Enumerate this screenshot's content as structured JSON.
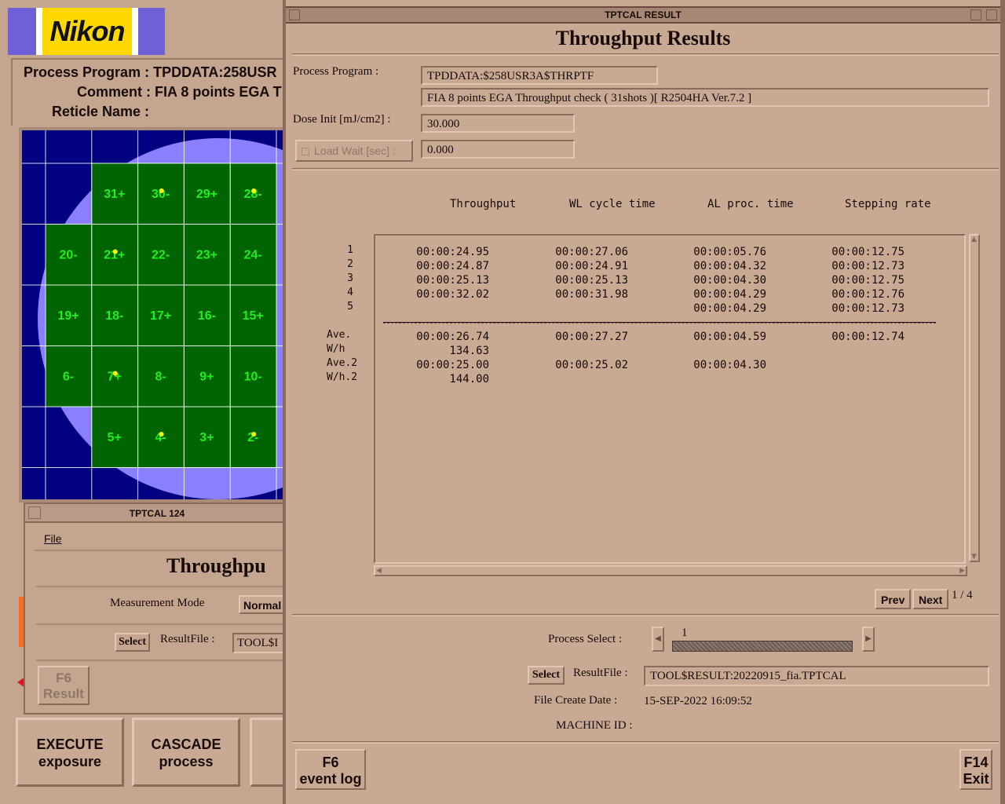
{
  "background_window": {
    "logo_text": "Nikon",
    "process_program_label": "Process Program :",
    "process_program_value": "TPDDATA:258USR",
    "comment_label": "Comment :",
    "comment_value": "FIA 8 points EGA T",
    "reticle_name_label": "Reticle Name :",
    "wafer_map": {
      "colors": {
        "background": "#000080",
        "wafer": "#8a80ff",
        "shot": "#006400",
        "label": "#22ee22",
        "marker": "#ffff00"
      },
      "shots": [
        {
          "label": "31+",
          "row": 1,
          "col": 2
        },
        {
          "label": "30-",
          "row": 1,
          "col": 3
        },
        {
          "label": "29+",
          "row": 1,
          "col": 4
        },
        {
          "label": "28-",
          "row": 1,
          "col": 5
        },
        {
          "label": "20-",
          "row": 2,
          "col": 1
        },
        {
          "label": "21+",
          "row": 2,
          "col": 2
        },
        {
          "label": "22-",
          "row": 2,
          "col": 3
        },
        {
          "label": "23+",
          "row": 2,
          "col": 4
        },
        {
          "label": "24-",
          "row": 2,
          "col": 5
        },
        {
          "label": "19+",
          "row": 3,
          "col": 1
        },
        {
          "label": "18-",
          "row": 3,
          "col": 2
        },
        {
          "label": "17+",
          "row": 3,
          "col": 3
        },
        {
          "label": "16-",
          "row": 3,
          "col": 4
        },
        {
          "label": "15+",
          "row": 3,
          "col": 5
        },
        {
          "label": "6-",
          "row": 4,
          "col": 1
        },
        {
          "label": "7+",
          "row": 4,
          "col": 2
        },
        {
          "label": "8-",
          "row": 4,
          "col": 3
        },
        {
          "label": "9+",
          "row": 4,
          "col": 4
        },
        {
          "label": "10-",
          "row": 4,
          "col": 5
        },
        {
          "label": "5+",
          "row": 5,
          "col": 2
        },
        {
          "label": "4-",
          "row": 5,
          "col": 3
        },
        {
          "label": "3+",
          "row": 5,
          "col": 4
        },
        {
          "label": "2-",
          "row": 5,
          "col": 5
        }
      ],
      "alignment_marks": [
        "30-",
        "28-",
        "21+",
        "7+",
        "4-",
        "2-"
      ]
    },
    "buttons": [
      {
        "line1": "EXECUTE",
        "line2": "exposure"
      },
      {
        "line1": "CASCADE",
        "line2": "process"
      }
    ]
  },
  "sub_window": {
    "title": "TPTCAL 124",
    "menu_file": "File",
    "heading": "Throughpu",
    "measurement_mode_label": "Measurement Mode",
    "measurement_mode_value": "Normal",
    "select_label": "Select",
    "result_file_label": "ResultFile :",
    "result_file_value": "TOOL$I",
    "f6_line1": "F6",
    "f6_line2": "Result"
  },
  "main_window": {
    "title": "TPTCAL RESULT",
    "heading": "Throughput Results",
    "process_program_label": "Process Program :",
    "process_program_value": "TPDDATA:$258USR3A$THRPTF",
    "comment_value": "FIA 8 points EGA Throughput check ( 31shots )[ R2504HA Ver.7.2 ]",
    "dose_init_label": "Dose Init [mJ/cm2] :",
    "dose_init_value": "30.000",
    "load_wait_label": "Load Wait [sec] :",
    "load_wait_value": "0.000",
    "table": {
      "columns": [
        "Throughput",
        "WL cycle time",
        "AL proc. time",
        "Stepping rate"
      ],
      "rows": [
        {
          "label": "1",
          "values": [
            "00:00:24.95",
            "00:00:27.06",
            "00:00:05.76",
            "00:00:12.75"
          ]
        },
        {
          "label": "2",
          "values": [
            "00:00:24.87",
            "00:00:24.91",
            "00:00:04.32",
            "00:00:12.73"
          ]
        },
        {
          "label": "3",
          "values": [
            "00:00:25.13",
            "00:00:25.13",
            "00:00:04.30",
            "00:00:12.75"
          ]
        },
        {
          "label": "4",
          "values": [
            "00:00:32.02",
            "00:00:31.98",
            "00:00:04.29",
            "00:00:12.76"
          ]
        },
        {
          "label": "5",
          "values": [
            "",
            "",
            "00:00:04.29",
            "00:00:12.73"
          ]
        }
      ],
      "summary": [
        {
          "label": "Ave.",
          "values": [
            "00:00:26.74",
            "00:00:27.27",
            "00:00:04.59",
            "00:00:12.74"
          ]
        },
        {
          "label": "W/h",
          "values": [
            "134.63",
            "",
            "",
            ""
          ]
        },
        {
          "label": "Ave.2",
          "values": [
            "00:00:25.00",
            "00:00:25.02",
            "00:00:04.30",
            ""
          ]
        },
        {
          "label": "W/h.2",
          "values": [
            "144.00",
            "",
            "",
            ""
          ]
        }
      ]
    },
    "prev_label": "Prev",
    "next_label": "Next",
    "page_indicator": "1 / 4",
    "process_select_label": "Process Select :",
    "process_select_value": "1",
    "select_label": "Select",
    "result_file_label": "ResultFile :",
    "result_file_value": "TOOL$RESULT:20220915_fia.TPTCAL",
    "file_create_date_label": "File Create Date :",
    "file_create_date_value": "15-SEP-2022 16:09:52",
    "machine_id_label": "MACHINE ID :",
    "machine_id_value": "",
    "f6_line1": "F6",
    "f6_line2": "event log",
    "f14_line1": "F14",
    "f14_line2": "Exit"
  }
}
